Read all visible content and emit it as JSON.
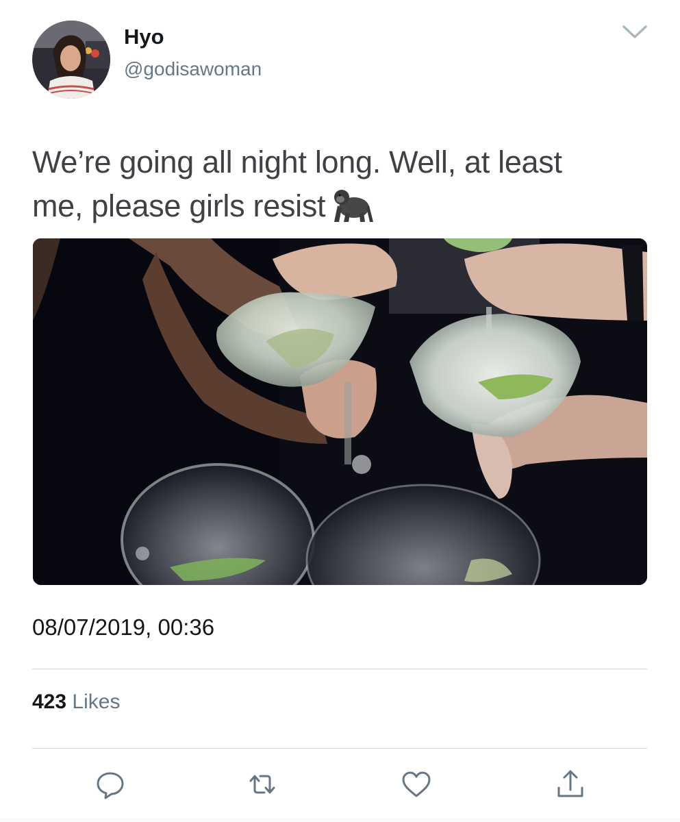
{
  "author": {
    "display_name": "Hyo",
    "handle": "@godisawoman"
  },
  "tweet": {
    "text_line1": "We’re going all night long. Well, at least",
    "text_line2": "me, please girls resist",
    "emoji": "gorilla-emoji",
    "timestamp": "08/07/2019, 00:36"
  },
  "stats": {
    "likes_count": "423",
    "likes_label": "Likes"
  },
  "actions": [
    {
      "name": "reply",
      "icon": "reply-icon"
    },
    {
      "name": "retweet",
      "icon": "retweet-icon"
    },
    {
      "name": "like",
      "icon": "heart-icon"
    },
    {
      "name": "share",
      "icon": "share-icon"
    }
  ],
  "colors": {
    "primary_text": "#14171a",
    "secondary_text": "#657786",
    "tweet_text": "#3e4145",
    "divider": "#d3d6d9",
    "icon": "#657786"
  }
}
